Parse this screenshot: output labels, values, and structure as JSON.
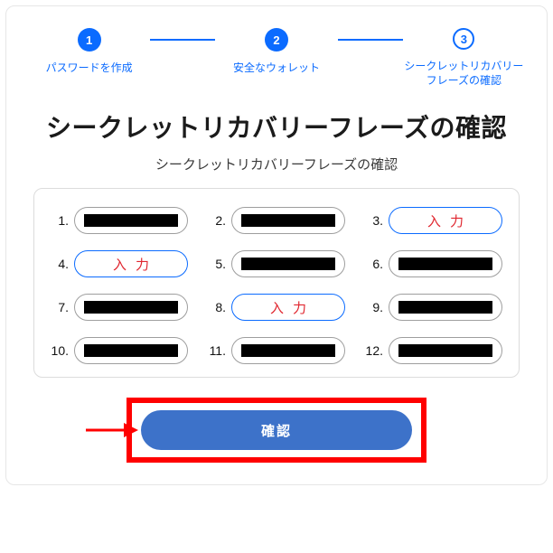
{
  "stepper": {
    "steps": [
      {
        "num": "1",
        "label": "パスワードを作成",
        "state": "done"
      },
      {
        "num": "2",
        "label": "安全なウォレット",
        "state": "done"
      },
      {
        "num": "3",
        "label": "シークレットリカバリーフレーズの確認",
        "state": "active"
      }
    ]
  },
  "heading": "シークレットリカバリーフレーズの確認",
  "subheading": "シークレットリカバリーフレーズの確認",
  "phrase": {
    "input_hint": "入力",
    "items": [
      {
        "n": "1.",
        "type": "filled"
      },
      {
        "n": "2.",
        "type": "filled"
      },
      {
        "n": "3.",
        "type": "input"
      },
      {
        "n": "4.",
        "type": "input"
      },
      {
        "n": "5.",
        "type": "filled"
      },
      {
        "n": "6.",
        "type": "filled"
      },
      {
        "n": "7.",
        "type": "filled"
      },
      {
        "n": "8.",
        "type": "input"
      },
      {
        "n": "9.",
        "type": "filled"
      },
      {
        "n": "10.",
        "type": "filled"
      },
      {
        "n": "11.",
        "type": "filled"
      },
      {
        "n": "12.",
        "type": "filled"
      }
    ]
  },
  "confirm_label": "確認",
  "annotation": {
    "arrow_color": "#ff0000",
    "frame_color": "#ff0000"
  }
}
